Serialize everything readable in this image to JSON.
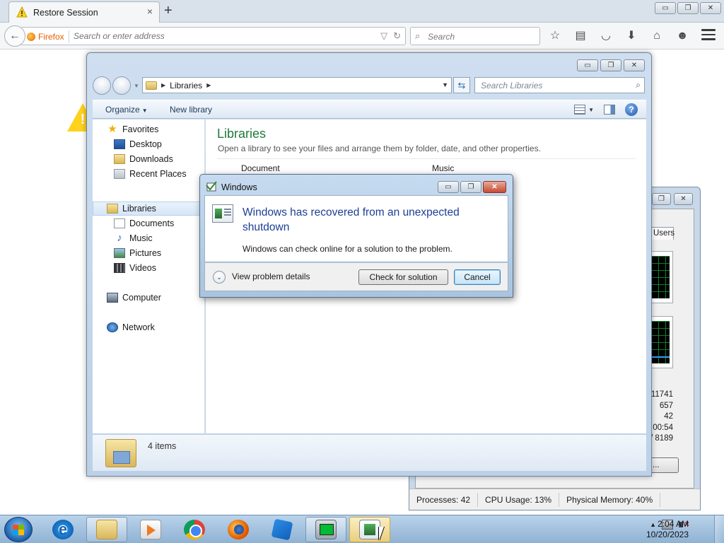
{
  "firefox": {
    "tab_title": "Restore Session",
    "tab_close": "×",
    "new_tab": "+",
    "identity_label": "Firefox",
    "url_placeholder": "Search or enter address",
    "search_placeholder": "Search",
    "window_controls": {
      "minimize": "▭",
      "restore": "❐",
      "close": "✕"
    },
    "toolbar_icons": [
      "star-icon",
      "reading-list-icon",
      "pocket-icon",
      "download-icon",
      "home-icon",
      "chat-icon",
      "menu-icon"
    ]
  },
  "explorer": {
    "window_controls": {
      "minimize": "▭",
      "restore": "❐",
      "close": "✕"
    },
    "address": {
      "crumb": "Libraries"
    },
    "search_placeholder": "Search Libraries",
    "commands": {
      "organize": "Organize",
      "new_library": "New library"
    },
    "nav": {
      "favorites": "Favorites",
      "desktop": "Desktop",
      "downloads": "Downloads",
      "recent_places": "Recent Places",
      "libraries": "Libraries",
      "documents": "Documents",
      "music": "Music",
      "pictures": "Pictures",
      "videos": "Videos",
      "computer": "Computer",
      "network": "Network"
    },
    "content": {
      "title": "Libraries",
      "subtitle": "Open a library to see your files and arrange them by folder, date, and other properties.",
      "partial_items": [
        "Document",
        "Music"
      ]
    },
    "details": {
      "count": "4 items"
    }
  },
  "dialog": {
    "title": "Windows",
    "heading": "Windows has recovered from an unexpected shutdown",
    "description": "Windows can check online for a solution to the problem.",
    "details_label": "View problem details",
    "check_button": "Check for solution",
    "cancel_button": "Cancel",
    "window_controls": {
      "minimize": "▭",
      "restore": "❐",
      "close": "✕"
    }
  },
  "task_manager": {
    "tab_users": "Users",
    "stats": [
      "11741",
      "657",
      "42",
      "00:54",
      "/ 8189"
    ],
    "button_partial": "...",
    "status": {
      "processes": "Processes: 42",
      "cpu": "CPU Usage: 13%",
      "memory": "Physical Memory: 40%"
    },
    "window_controls": {
      "restore": "❐",
      "close": "✕"
    }
  },
  "taskbar": {
    "pinned": [
      "internet-explorer-icon",
      "explorer-icon",
      "media-player-icon",
      "chrome-icon",
      "firefox-icon",
      "app-icon",
      "task-manager-icon",
      "error-reporting-icon"
    ],
    "time": "2:04 AM",
    "date": "10/20/2023"
  },
  "colors": {
    "library_title": "#1e7a3a",
    "dialog_heading": "#1c3f94",
    "firefox_accent": "#e66000"
  }
}
